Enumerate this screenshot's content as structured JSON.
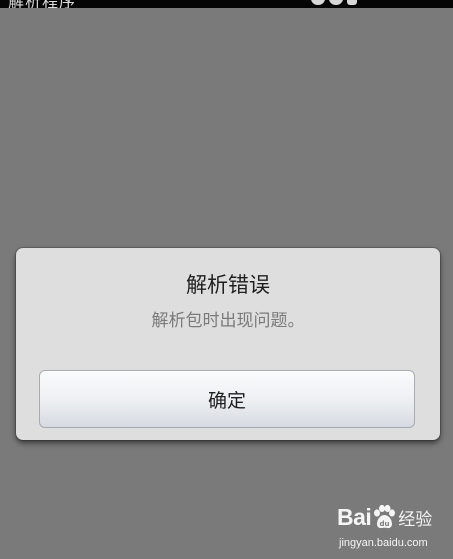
{
  "status_bar": {
    "title": "解析程序"
  },
  "dialog": {
    "title": "解析错误",
    "message": "解析包时出现问题。",
    "confirm_label": "确定"
  },
  "watermark": {
    "brand": "Bai",
    "brand_suffix": "经验",
    "url": "jingyan.baidu.com",
    "logo_icon": "paw-icon"
  },
  "colors": {
    "background_dim": "#7a7a7a",
    "dialog_bg": "#dedede",
    "button_border": "#a9abb0",
    "title_text": "#1f1f1f",
    "message_text": "#7b7b7b"
  }
}
